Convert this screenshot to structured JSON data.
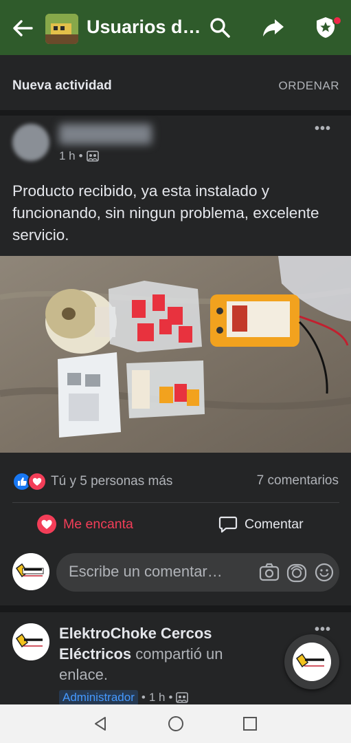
{
  "header": {
    "title": "Usuarios d…",
    "bg_color": "#2f5b2b"
  },
  "sort": {
    "title": "Nueva actividad",
    "button": "ORDENAR"
  },
  "post": {
    "time": "1 h",
    "text": "Producto recibido, ya esta instalado y funcionando, sin ningun problema, excelente servicio.",
    "reactions_text": "Tú y 5 personas más",
    "comments_count": "7 comentarios",
    "love_label": "Me encanta",
    "comment_label": "Comentar",
    "comment_placeholder": "Escribe un comentar…"
  },
  "post2": {
    "page_name": "ElektroChoke Cercos Eléctricos",
    "action": " compartió un enlace.",
    "admin_badge": "Administrador",
    "time": "1 h"
  },
  "colors": {
    "love": "#f33e58",
    "like": "#1877f2",
    "admin": "#4599ff"
  }
}
